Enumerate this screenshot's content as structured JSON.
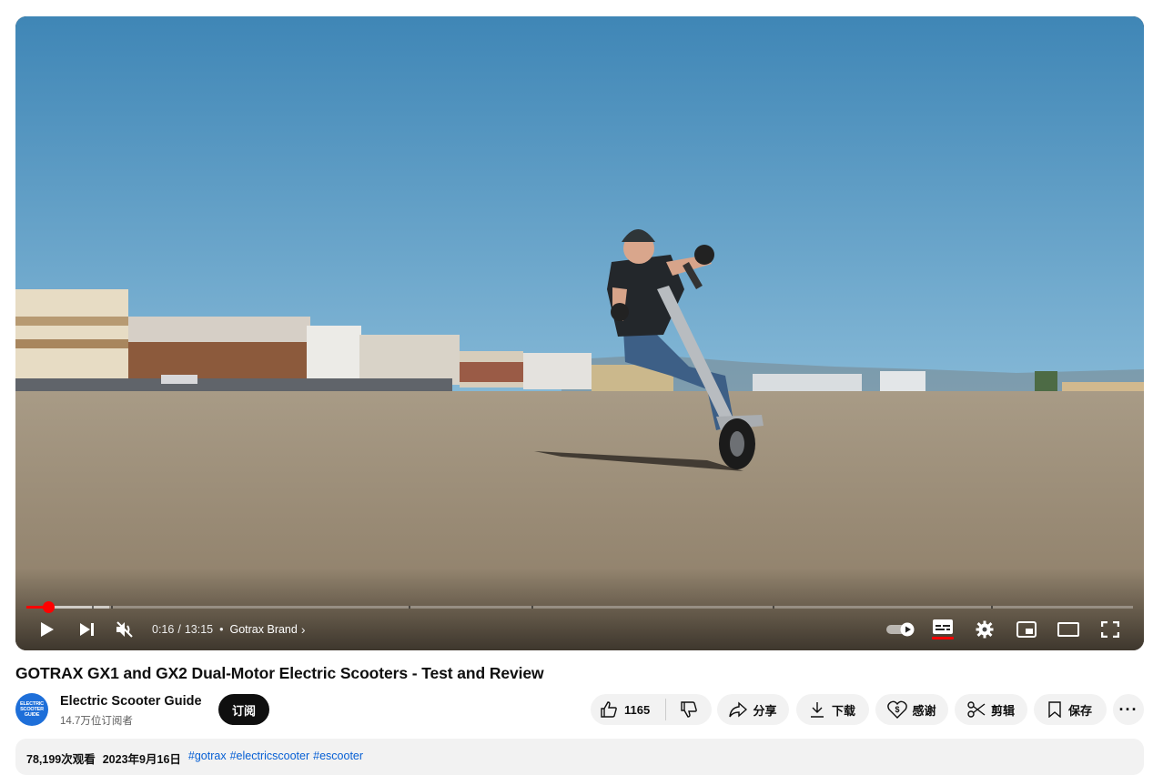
{
  "player": {
    "time_current": "0:16",
    "time_total": "13:15",
    "time_separator": "/",
    "chapter": "Gotrax Brand",
    "progress_fraction": 0.02,
    "buffered_fraction": 0.075,
    "muted": true,
    "autoplay_on": true,
    "captions_on": true,
    "accent_color": "#ff0000"
  },
  "video": {
    "title": "GOTRAX GX1 and GX2 Dual-Motor Electric Scooters - Test and Review",
    "views": "78,199次观看",
    "date": "2023年9月16日",
    "tags": [
      "#gotrax",
      "#electricscooter",
      "#escooter"
    ]
  },
  "channel": {
    "avatar_lines": [
      "ELECTRIC",
      "SCOOTER",
      "GUIDE"
    ],
    "name": "Electric Scooter Guide",
    "subscribers": "14.7万位订阅者",
    "subscribe_label": "订阅"
  },
  "actions": {
    "like_count": "1165",
    "share_label": "分享",
    "download_label": "下载",
    "thanks_label": "感谢",
    "clip_label": "剪辑",
    "save_label": "保存"
  },
  "icons": {
    "play": "play-icon",
    "next": "next-icon",
    "mute": "volume-muted-icon",
    "autoplay": "autoplay-toggle-icon",
    "captions": "subtitles-icon",
    "settings": "gear-icon",
    "miniplayer": "miniplayer-icon",
    "theater": "theater-icon",
    "fullscreen": "fullscreen-icon"
  }
}
